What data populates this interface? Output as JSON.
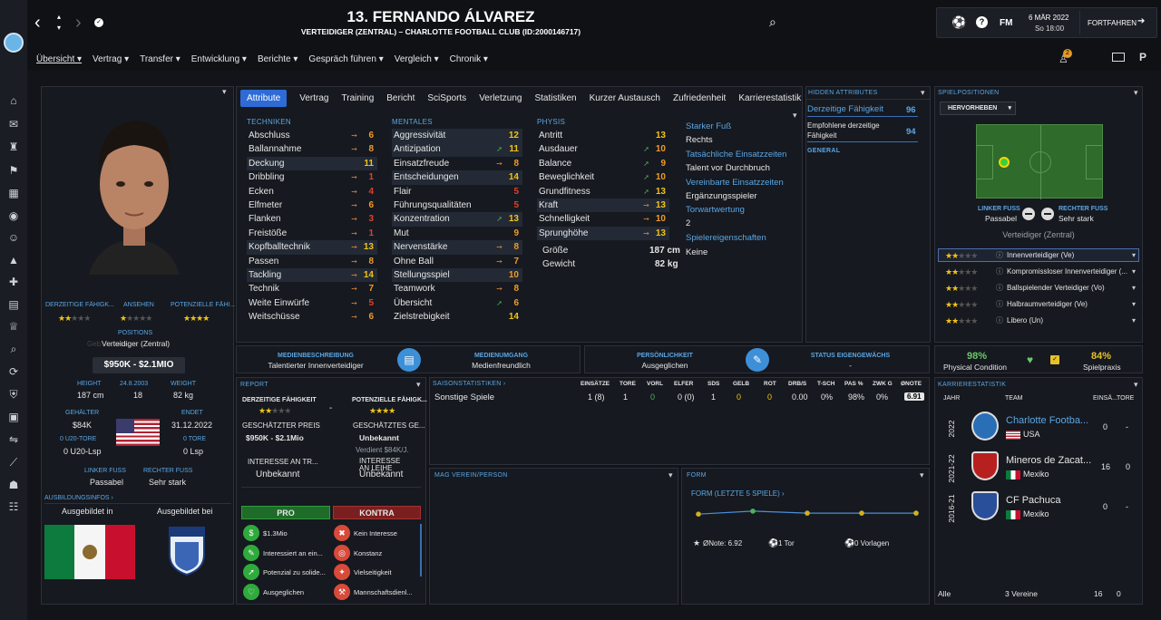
{
  "header": {
    "title": "13. FERNANDO ÁLVAREZ",
    "subtitle": "VERTEIDIGER (ZENTRAL) – CHARLOTTE FOOTBALL CLUB (ID:2000146717)",
    "date": "6 MÄR 2022",
    "time": "So 18:00",
    "fm_label": "FM",
    "continue_label": "FORTFAHREN",
    "notif_count": "2"
  },
  "menu": [
    "Übersicht ▾",
    "Vertrag ▾",
    "Transfer ▾",
    "Entwicklung ▾",
    "Berichte ▾",
    "Gespräch führen ▾",
    "Vergleich ▾",
    "Chronik ▾"
  ],
  "tabs": [
    "Attribute",
    "Vertrag",
    "Training",
    "Bericht",
    "SciSports",
    "Verletzung",
    "Statistiken",
    "Kurzer Austausch",
    "Zufriedenheit",
    "Karrierestatistik"
  ],
  "left": {
    "cur_ability_label": "DERZEITIGE FÄHIGK...",
    "reputation_label": "ANSEHEN",
    "pot_ability_label": "POTENZIELLE FÄHI...",
    "positions_label": "POSITIONS",
    "position": "Verteidiger (Zentral)",
    "bg_text": "Geb... ...uca",
    "value": "$950K - $2.1MIO",
    "height_label": "HEIGHT",
    "height": "187 cm",
    "dob": "24.8.2003",
    "age": "18",
    "weight_label": "WEIGHT",
    "weight": "82 kg",
    "wage_label": "GEHÄLTER",
    "wage": "$84K",
    "ends_label": "ENDET",
    "ends": "31.12.2022",
    "u20_goals_label": "0 U20-TORE",
    "u20_apps": "0 U20-Lsp",
    "goals_label": "0 TORE",
    "apps": "0 Lsp",
    "left_foot_label": "LINKER FUSS",
    "left_foot": "Passabel",
    "right_foot_label": "RECHTER FUSS",
    "right_foot": "Sehr stark",
    "training_label": "AUSBILDUNGSINFOS ›",
    "trained_in_label": "Ausgebildet in",
    "trained_at_label": "Ausgebildet bei"
  },
  "attributes": {
    "tech_title": "TECHNIKEN",
    "mental_title": "MENTALES",
    "phys_title": "PHYSIS",
    "technical": [
      {
        "n": "Abschluss",
        "v": "6",
        "a": "o",
        "h": false
      },
      {
        "n": "Ballannahme",
        "v": "8",
        "a": "o",
        "h": false
      },
      {
        "n": "Deckung",
        "v": "11",
        "a": "",
        "h": true
      },
      {
        "n": "Dribbling",
        "v": "1",
        "a": "o",
        "h": false
      },
      {
        "n": "Ecken",
        "v": "4",
        "a": "o",
        "h": false
      },
      {
        "n": "Elfmeter",
        "v": "6",
        "a": "o",
        "h": false
      },
      {
        "n": "Flanken",
        "v": "3",
        "a": "o",
        "h": false
      },
      {
        "n": "Freistöße",
        "v": "1",
        "a": "o",
        "h": false
      },
      {
        "n": "Kopfballtechnik",
        "v": "13",
        "a": "o",
        "h": true
      },
      {
        "n": "Passen",
        "v": "8",
        "a": "o",
        "h": false
      },
      {
        "n": "Tackling",
        "v": "14",
        "a": "o",
        "h": true
      },
      {
        "n": "Technik",
        "v": "7",
        "a": "o",
        "h": false
      },
      {
        "n": "Weite Einwürfe",
        "v": "5",
        "a": "o",
        "h": false
      },
      {
        "n": "Weitschüsse",
        "v": "6",
        "a": "o",
        "h": false
      }
    ],
    "mental": [
      {
        "n": "Aggressivität",
        "v": "12",
        "a": "",
        "h": true
      },
      {
        "n": "Antizipation",
        "v": "11",
        "a": "g",
        "h": true
      },
      {
        "n": "Einsatzfreude",
        "v": "8",
        "a": "o",
        "h": false
      },
      {
        "n": "Entscheidungen",
        "v": "14",
        "a": "",
        "h": true
      },
      {
        "n": "Flair",
        "v": "5",
        "a": "",
        "h": false
      },
      {
        "n": "Führungsqualitäten",
        "v": "5",
        "a": "",
        "h": false
      },
      {
        "n": "Konzentration",
        "v": "13",
        "a": "g",
        "h": true
      },
      {
        "n": "Mut",
        "v": "9",
        "a": "",
        "h": false
      },
      {
        "n": "Nervenstärke",
        "v": "8",
        "a": "o",
        "h": true
      },
      {
        "n": "Ohne Ball",
        "v": "7",
        "a": "o",
        "h": false
      },
      {
        "n": "Stellungsspiel",
        "v": "10",
        "a": "",
        "h": true
      },
      {
        "n": "Teamwork",
        "v": "8",
        "a": "o",
        "h": false
      },
      {
        "n": "Übersicht",
        "v": "6",
        "a": "g",
        "h": false
      },
      {
        "n": "Zielstrebigkeit",
        "v": "14",
        "a": "",
        "h": false
      }
    ],
    "physical": [
      {
        "n": "Antritt",
        "v": "13",
        "a": "",
        "h": false
      },
      {
        "n": "Ausdauer",
        "v": "10",
        "a": "g",
        "h": false
      },
      {
        "n": "Balance",
        "v": "9",
        "a": "g",
        "h": false
      },
      {
        "n": "Beweglichkeit",
        "v": "10",
        "a": "g",
        "h": false
      },
      {
        "n": "Grundfitness",
        "v": "13",
        "a": "g",
        "h": false
      },
      {
        "n": "Kraft",
        "v": "13",
        "a": "o",
        "h": true
      },
      {
        "n": "Schnelligkeit",
        "v": "10",
        "a": "o",
        "h": false
      },
      {
        "n": "Sprunghöhe",
        "v": "13",
        "a": "o",
        "h": true
      }
    ],
    "size_label": "Größe",
    "size": "187 cm",
    "weight_label": "Gewicht",
    "weight": "82 kg",
    "strong_foot_label": "Starker Fuß",
    "strong_foot": "Rechts",
    "actual_label": "Tatsächliche Einsatzzeiten",
    "actual": "Talent vor Durchbruch",
    "agreed_label": "Vereinbarte Einsatzzeiten",
    "agreed": "Ergänzungsspieler",
    "goal_exp_label": "Torwartwertung",
    "goal_exp": "2",
    "traits_label": "Spielereigenschaften",
    "traits": "Keine"
  },
  "hidden": {
    "title": "HIDDEN ATTRIBUTES",
    "cur_label": "Derzeitige Fähigkeit",
    "cur": "96",
    "rec_label": "Empfohlene derzeitige Fähigkeit",
    "rec": "94",
    "general": "GENERAL"
  },
  "positions": {
    "title": "SPIELPOSITIONEN",
    "dropdown": "HERVORHEBEN",
    "left_foot_label": "LINKER FUSS",
    "left_foot": "Passabel",
    "right_foot_label": "RECHTER FUSS",
    "right_foot": "Sehr stark",
    "position": "Verteidiger (Zentral)",
    "roles": [
      {
        "stars": 2,
        "name": "Innenverteidiger (Ve)"
      },
      {
        "stars": 2,
        "name": "Kompromissloser Innenverteidiger (..."
      },
      {
        "stars": 2,
        "name": "Ballspielender Verteidiger (Vo)"
      },
      {
        "stars": 2,
        "name": "Halbraumverteidiger (Ve)"
      },
      {
        "stars": 2,
        "name": "Libero (Un)"
      }
    ]
  },
  "media": {
    "desc_label": "MEDIENBESCHREIBUNG",
    "desc": "Talentierter Innenverteidiger",
    "handling_label": "MEDIENUMGANG",
    "handling": "Medienfreundlich",
    "personality_label": "PERSÖNLICHKEIT",
    "personality": "Ausgeglichen",
    "homegrown_label": "STATUS EIGENGEWÄCHS",
    "homegrown": "-"
  },
  "condition": {
    "cond": "98%",
    "cond_label": "Physical Condition",
    "prac": "84%",
    "prac_label": "Spielpraxis"
  },
  "report": {
    "title": "REPORT",
    "cur_label": "DERZEITIGE FÄHIGKEIT",
    "pot_label": "POTENZIELLE FÄHIGK...",
    "dash": "-",
    "est_price_label": "GESCHÄTZTER PREIS",
    "est_price": "$950K - $2.1Mio",
    "est_wage_label": "GESCHÄTZTES GE...",
    "est_wage": "Unbekannt",
    "wage_note": "Verdient $84K/J.",
    "int_transfer_label": "INTERESSE AN TR...",
    "int_transfer": "Unbekannt",
    "int_loan_label": "INTERESSE AN LEIHE",
    "int_loan": "Unbekannt",
    "pro_label": "PRO",
    "con_label": "KONTRA",
    "pros": [
      "$1.3Mio",
      "Interessiert an ein...",
      "Potenzial zu solide...",
      "Ausgeglichen"
    ],
    "cons": [
      "Kein Interesse",
      "Konstanz",
      "Vielseitigkeit",
      "Mannschaftsdienl..."
    ]
  },
  "season": {
    "title": "SAISONSTATISTIKEN ›",
    "cols": [
      "EINSÄTZE",
      "TORE",
      "VORL",
      "ELFER",
      "SDS",
      "GELB",
      "ROT",
      "DRB/S",
      "T-SCH",
      "PAS %",
      "ZWK G",
      "ØNOTE"
    ],
    "row_label": "Sonstige Spiele",
    "row": [
      "1 (8)",
      "1",
      "0",
      "0 (0)",
      "1",
      "0",
      "0",
      "0.00",
      "0%",
      "98%",
      "0%",
      "6.91"
    ]
  },
  "likes": {
    "title": "MAG VEREIN/PERSON"
  },
  "form": {
    "title": "FORM",
    "subtitle": "FORM (LETZTE 5 SPIELE) ›",
    "avg": "ØNote: 6.92",
    "goals": "1 Tor",
    "assists": "0 Vorlagen",
    "values": [
      6.8,
      7.1,
      6.9,
      6.9,
      6.9
    ]
  },
  "career": {
    "title": "KARRIERESTATISTIK",
    "year_label": "JAHR",
    "team_label": "TEAM",
    "apps_label": "EINSÄ...",
    "goals_label": "TORE",
    "rows": [
      {
        "year": "2022",
        "team": "Charlotte Footba...",
        "country": "USA",
        "apps": "0",
        "goals": "-"
      },
      {
        "year": "2021-22",
        "team": "Mineros de Zacat...",
        "country": "Mexiko",
        "apps": "16",
        "goals": "0"
      },
      {
        "year": "2016-21",
        "team": "CF Pachuca",
        "country": "Mexiko",
        "apps": "0",
        "goals": "-"
      }
    ],
    "total_label": "Alle",
    "total_clubs": "3 Vereine",
    "total_apps": "16",
    "total_goals": "0"
  }
}
